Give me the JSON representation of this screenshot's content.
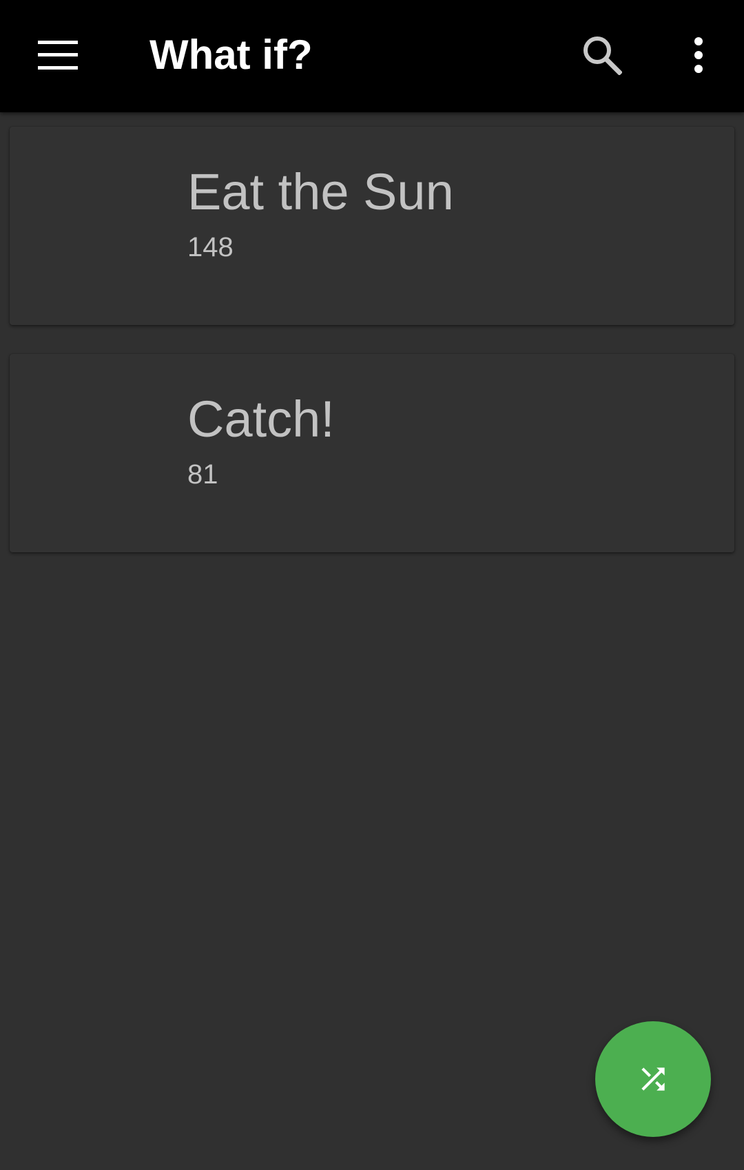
{
  "appbar": {
    "title": "What if?",
    "menu_icon": "menu-icon",
    "search_icon": "search-icon",
    "overflow_icon": "more-vert-icon"
  },
  "articles": [
    {
      "title": "Eat the Sun",
      "number": "148"
    },
    {
      "title": "Catch!",
      "number": "81"
    }
  ],
  "fab": {
    "icon": "shuffle-icon"
  },
  "colors": {
    "appbar": "#000000",
    "background": "#303030",
    "card": "#323232",
    "card_text": "#c2c2c2",
    "fab": "#4caf50"
  }
}
